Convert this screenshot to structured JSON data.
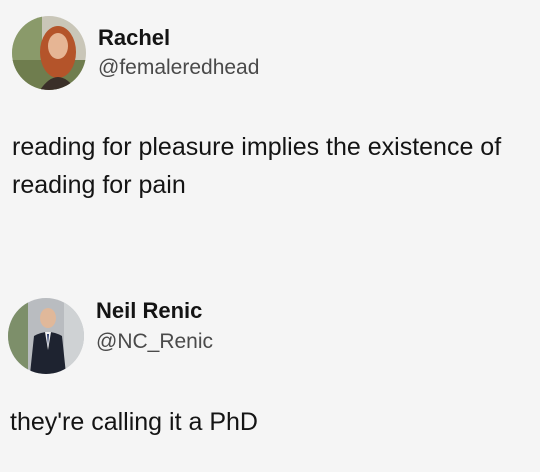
{
  "posts": [
    {
      "author": {
        "name": "Rachel",
        "handle": "@femaleredhead",
        "avatar_icon": "avatar-woman-red-hair"
      },
      "text": "reading for pleasure implies the existence of reading for pain"
    },
    {
      "author": {
        "name": "Neil Renic",
        "handle": "@NC_Renic",
        "avatar_icon": "avatar-man-suit"
      },
      "text": "they're calling it a PhD"
    }
  ],
  "colors": {
    "background": "#f5f5f5",
    "text": "#141414",
    "handle": "#4a4a4a"
  }
}
